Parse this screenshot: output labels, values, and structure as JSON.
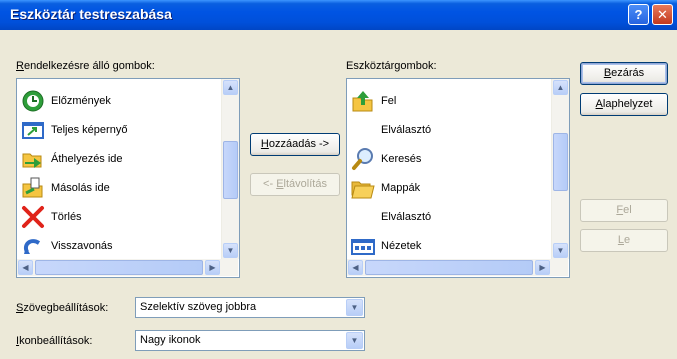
{
  "window": {
    "title": "Eszköztár testreszabása",
    "help": "?",
    "close": "✕"
  },
  "available": {
    "label_ul": "R",
    "label_rest": "endelkezésre álló gombok:",
    "items": [
      {
        "label": "Előzmények",
        "icon": "history-icon"
      },
      {
        "label": "Teljes képernyő",
        "icon": "fullscreen-icon"
      },
      {
        "label": "Áthelyezés ide",
        "icon": "move-to-icon"
      },
      {
        "label": "Másolás ide",
        "icon": "copy-to-icon"
      },
      {
        "label": "Törlés",
        "icon": "delete-icon"
      },
      {
        "label": "Visszavonás",
        "icon": "undo-icon"
      }
    ]
  },
  "current": {
    "label_pre": "Eszköztár",
    "label_ul": "g",
    "label_rest": "ombok:",
    "items": [
      {
        "label": "Fel",
        "icon": "up-folder-icon"
      },
      {
        "label": "Elválasztó",
        "icon": ""
      },
      {
        "label": "Keresés",
        "icon": "search-icon"
      },
      {
        "label": "Mappák",
        "icon": "folders-icon"
      },
      {
        "label": "Elválasztó",
        "icon": ""
      },
      {
        "label": "Nézetek",
        "icon": "views-icon"
      }
    ]
  },
  "buttons": {
    "add_ul": "H",
    "add_rest": "ozzáadás ->",
    "remove_pre": "<- ",
    "remove_ul": "E",
    "remove_rest": "ltávolítás",
    "close_ul": "B",
    "close_rest": "ezárás",
    "reset_ul": "A",
    "reset_rest": "laphelyzet",
    "up_ul": "F",
    "up_rest": "el",
    "down_ul": "L",
    "down_rest": "e"
  },
  "text_options": {
    "label_ul": "S",
    "label_rest": "zövegbeállítások:",
    "value": "Szelektív szöveg jobbra"
  },
  "icon_options": {
    "label_ul": "I",
    "label_rest": "konbeállítások:",
    "value": "Nagy ikonok"
  }
}
